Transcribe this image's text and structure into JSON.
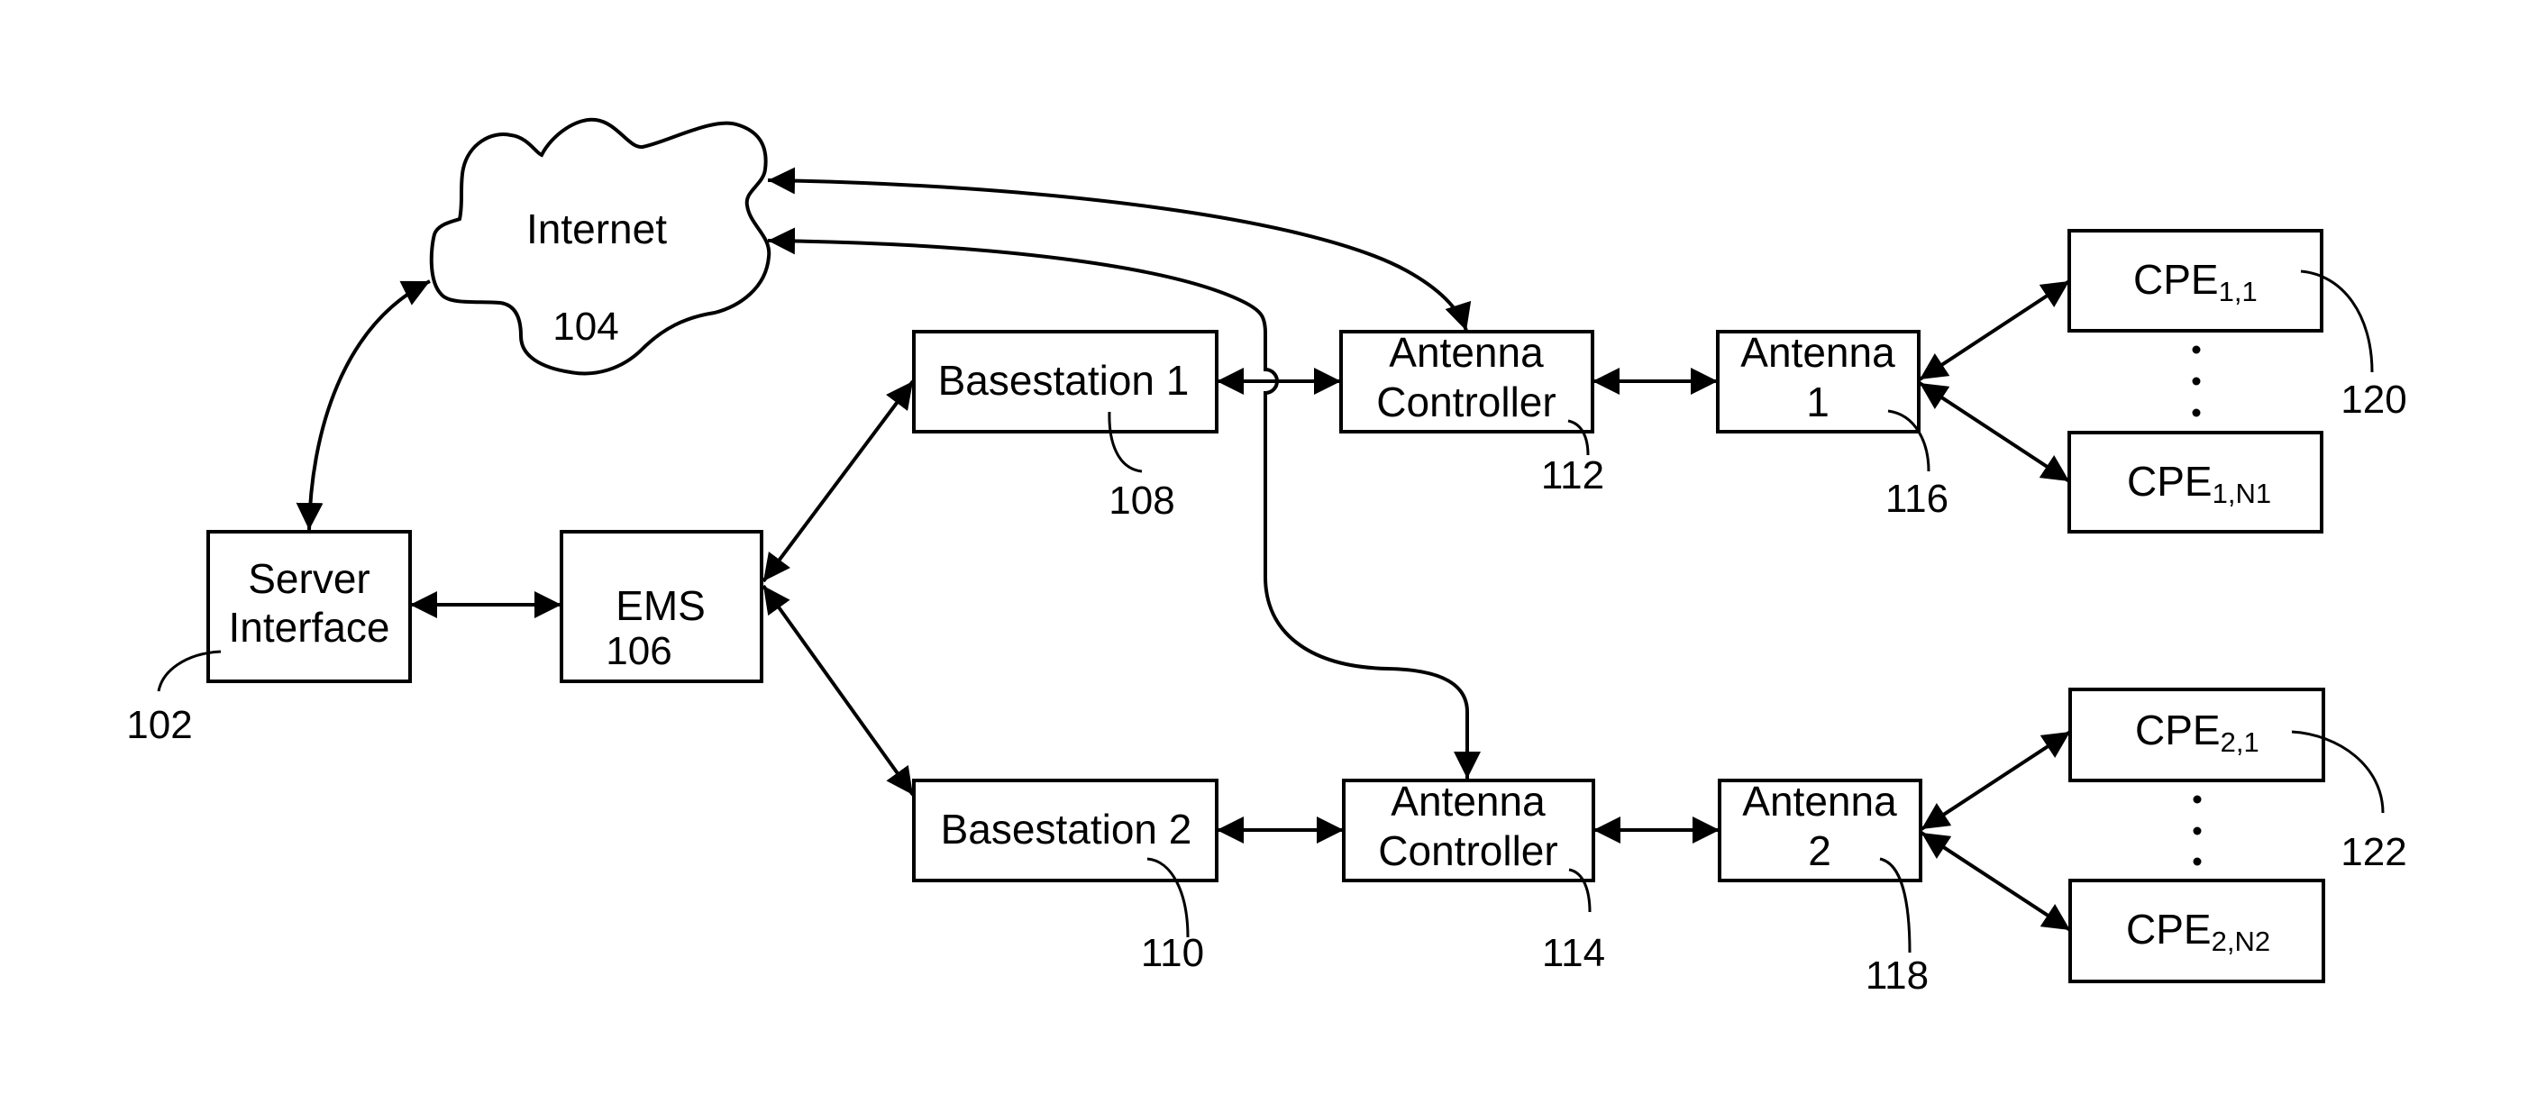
{
  "diagram": {
    "type": "network-architecture",
    "nodes": {
      "internet": {
        "label": "Internet",
        "ref": "104"
      },
      "server_interface": {
        "label_lines": [
          "Server",
          "Interface"
        ],
        "ref": "102"
      },
      "ems": {
        "label": "EMS",
        "ref": "106"
      },
      "basestation_1": {
        "label": "Basestation 1",
        "ref": "108"
      },
      "basestation_2": {
        "label": "Basestation 2",
        "ref": "110"
      },
      "antenna_controller_1": {
        "label_lines": [
          "Antenna",
          "Controller"
        ],
        "ref": "112"
      },
      "antenna_controller_2": {
        "label_lines": [
          "Antenna",
          "Controller"
        ],
        "ref": "114"
      },
      "antenna_1": {
        "label_lines": [
          "Antenna",
          "1"
        ],
        "ref": "116"
      },
      "antenna_2": {
        "label_lines": [
          "Antenna",
          "2"
        ],
        "ref": "118"
      },
      "cpe_1_1": {
        "base": "CPE",
        "sub": "1,1"
      },
      "cpe_1_n1": {
        "base": "CPE",
        "sub": "1,N1"
      },
      "cpe_2_1": {
        "base": "CPE",
        "sub": "2,1"
      },
      "cpe_2_n2": {
        "base": "CPE",
        "sub": "2,N2"
      },
      "cpe_group_1": {
        "ref": "120",
        "ellipsis": "⋮"
      },
      "cpe_group_2": {
        "ref": "122",
        "ellipsis": "⋮"
      }
    },
    "edges": [
      {
        "from": "server_interface",
        "to": "internet",
        "direction": "bidirectional"
      },
      {
        "from": "server_interface",
        "to": "ems",
        "direction": "bidirectional"
      },
      {
        "from": "ems",
        "to": "basestation_1",
        "direction": "bidirectional"
      },
      {
        "from": "ems",
        "to": "basestation_2",
        "direction": "bidirectional"
      },
      {
        "from": "basestation_1",
        "to": "antenna_controller_1",
        "direction": "bidirectional"
      },
      {
        "from": "basestation_2",
        "to": "antenna_controller_2",
        "direction": "bidirectional"
      },
      {
        "from": "antenna_controller_1",
        "to": "antenna_1",
        "direction": "bidirectional"
      },
      {
        "from": "antenna_controller_2",
        "to": "antenna_2",
        "direction": "bidirectional"
      },
      {
        "from": "antenna_1",
        "to": "cpe_1_1",
        "direction": "bidirectional"
      },
      {
        "from": "antenna_1",
        "to": "cpe_1_n1",
        "direction": "bidirectional"
      },
      {
        "from": "antenna_2",
        "to": "cpe_2_1",
        "direction": "bidirectional"
      },
      {
        "from": "antenna_2",
        "to": "cpe_2_n2",
        "direction": "bidirectional"
      },
      {
        "from": "internet",
        "to": "antenna_controller_1",
        "direction": "bidirectional"
      },
      {
        "from": "internet",
        "to": "antenna_controller_2",
        "direction": "bidirectional"
      }
    ]
  }
}
